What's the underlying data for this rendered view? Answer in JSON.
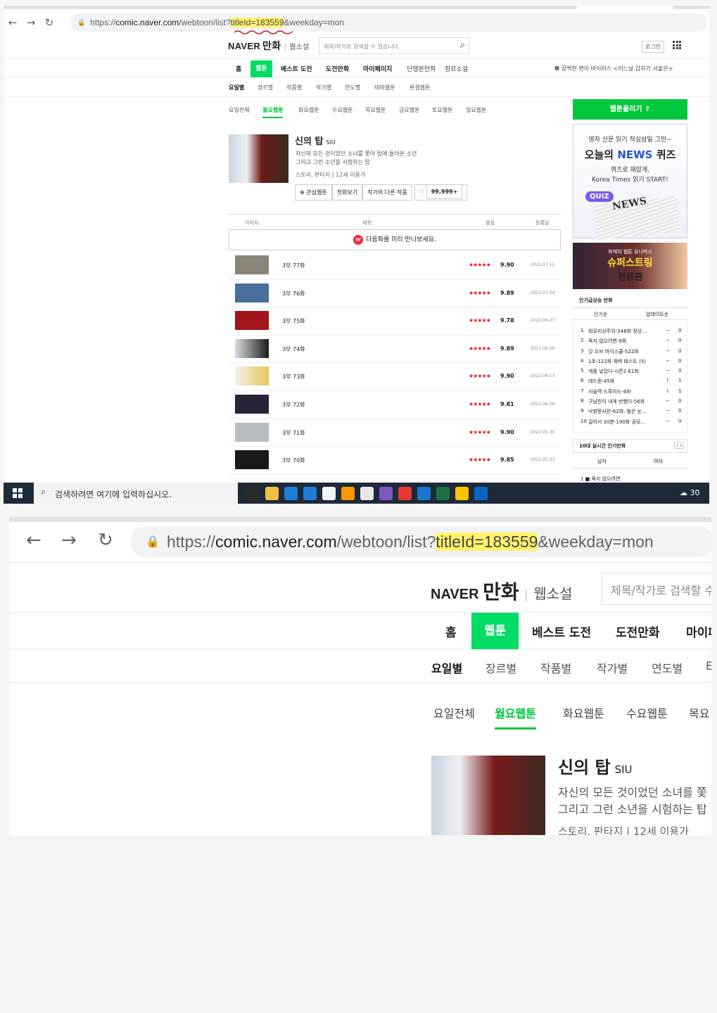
{
  "browser": {
    "url_prefix": "https://",
    "url_host": "comic.naver.com",
    "url_path": "/webtoon/list?",
    "url_highlight": "titleId=183559",
    "url_suffix": "&weekday=mon"
  },
  "header": {
    "logo_naver": "NAVER",
    "logo_manhwa": "만화",
    "novel": "웹소설",
    "search_placeholder": "제목/작가로 검색할 수 있습니다.",
    "login": "로그인"
  },
  "menu": {
    "items": [
      "홈",
      "웹툰",
      "베스트 도전",
      "도전만화",
      "마이페이지",
      "단행본만화",
      "장르소설"
    ],
    "notice": "끔찍한 변이 바이러스 <어느날 갑자기 서울은>"
  },
  "submenu": [
    "요일별",
    "장르별",
    "작품별",
    "작가별",
    "연도별",
    "테마웹툰",
    "완결웹툰"
  ],
  "days": [
    "요일전체",
    "월요웹툰",
    "화요웹툰",
    "수요웹툰",
    "목요웹툰",
    "금요웹툰",
    "토요웹툰",
    "일요웹툰"
  ],
  "webtoon": {
    "title": "신의 탑",
    "author": "SIU",
    "desc1": "자신의 모든 것이었던 소녀를 쫓아 탑에 들어온 소년",
    "desc2": "그리고 그런 소년을 시험하는 탑",
    "meta": "스토리, 판타지  |  12세 이용가",
    "btn_fav": "⊕ 관심웹툰",
    "btn_first": "첫회보기",
    "btn_other": "작가의 다른 작품",
    "likes": "99,999+"
  },
  "table": {
    "headers": [
      "이미지",
      "제목",
      "별점",
      "등록일"
    ],
    "preview": "다음화를 미리 만나보세요.",
    "preview_badge": "W",
    "stars": "★★★★★",
    "rows": [
      {
        "title": "3부 77화",
        "score": "9.90",
        "date": "2021.07.11"
      },
      {
        "title": "3부 76화",
        "score": "9.89",
        "date": "2021.07.04"
      },
      {
        "title": "3부 75화",
        "score": "9.78",
        "date": "2021.06.27"
      },
      {
        "title": "3부 74화",
        "score": "9.89",
        "date": "2021.06.20"
      },
      {
        "title": "3부 73화",
        "score": "9.90",
        "date": "2021.06.13"
      },
      {
        "title": "3부 72화",
        "score": "9.81",
        "date": "2021.06.06"
      },
      {
        "title": "3부 71화",
        "score": "9.90",
        "date": "2021.05.30"
      },
      {
        "title": "3부 70화",
        "score": "9.85",
        "date": "2021.05.23"
      }
    ]
  },
  "sidebar": {
    "upload": "웹툰올리기 ⇪",
    "ad1_line1": "영자 신문 읽기 작심삼일 그만~",
    "ad1_line2a": "오늘의 ",
    "ad1_line2b": "NEWS",
    "ad1_line2c": " 퀴즈",
    "ad1_line3": "퀴즈로 재밌게,",
    "ad1_line4": "Korea Times 읽기 START!",
    "ad1_quiz": "QUIZ",
    "ad1_news": "NEWS",
    "ad2_line1": "화제의 웹툰 유니버스",
    "ad2_line2": "슈퍼스트링",
    "ad2_line3": "전용관",
    "rank_title": "인기급상승 만화",
    "rank_tab1": "인기순",
    "rank_tab2": "업데이트순",
    "rank": [
      {
        "n": "1",
        "t": "외모지상주의-348화 정상...",
        "a": "−",
        "c": "0"
      },
      {
        "n": "2",
        "t": "죽지 않으려면-9화",
        "a": "−",
        "c": "0"
      },
      {
        "n": "3",
        "t": "갓 오브 하이스쿨-522화",
        "a": "−",
        "c": "0"
      },
      {
        "n": "4",
        "t": "1초-122화 체력 테스트 (5)",
        "a": "−",
        "c": "0"
      },
      {
        "n": "5",
        "t": "개를 낳았다-시즌2 61화",
        "a": "−",
        "c": "0"
      },
      {
        "n": "6",
        "t": "데드퀸-45화",
        "a": "↑",
        "c": "1"
      },
      {
        "n": "7",
        "t": "서울역 드루이드-6화",
        "a": "↓",
        "c": "1"
      },
      {
        "n": "8",
        "t": "구남친이 내게 반했다-56화",
        "a": "−",
        "c": "0"
      },
      {
        "n": "9",
        "t": "낙향문사전-62화. 힘은 눈...",
        "a": "−",
        "c": "0"
      },
      {
        "n": "10",
        "t": "걸어서 30분-190화 공모...",
        "a": "−",
        "c": "0"
      }
    ],
    "live_title": "10대 실시간 인기만화",
    "live_pager": "‹ ›",
    "gender_m": "남자",
    "gender_f": "여자",
    "partial": "1  ■ 죽지 않으려면"
  },
  "taskbar": {
    "search": "검색하려면 여기에 입력하십시오.",
    "temp": "30",
    "app_colors": [
      "#2b2b2b",
      "#f0c040",
      "#1e7fd6",
      "#1f7ad6",
      "#f4f4f4",
      "#ff9800",
      "#e8e8e8",
      "#7e57c2",
      "#e53935",
      "#1976d2",
      "#1e7145",
      "#f9c300",
      "#0a66c2"
    ]
  },
  "zoom": {
    "search_placeholder": "제목/작가로 검색할 수",
    "menu": [
      "홈",
      "웹툰",
      "베스트 도전",
      "도전만화",
      "마이페"
    ],
    "sub": [
      "요일별",
      "장르별",
      "작품별",
      "작가별",
      "연도별",
      "E"
    ],
    "days": [
      "요일전체",
      "월요웹툰",
      "화요웹툰",
      "수요웹툰",
      "목요"
    ],
    "desc1": "자신의 모든 것이었던 소녀를 쫓",
    "desc2": "그리고 그런 소년을 시험하는 탑",
    "meta": "스토리, 판타지  |  12세 이용가"
  }
}
